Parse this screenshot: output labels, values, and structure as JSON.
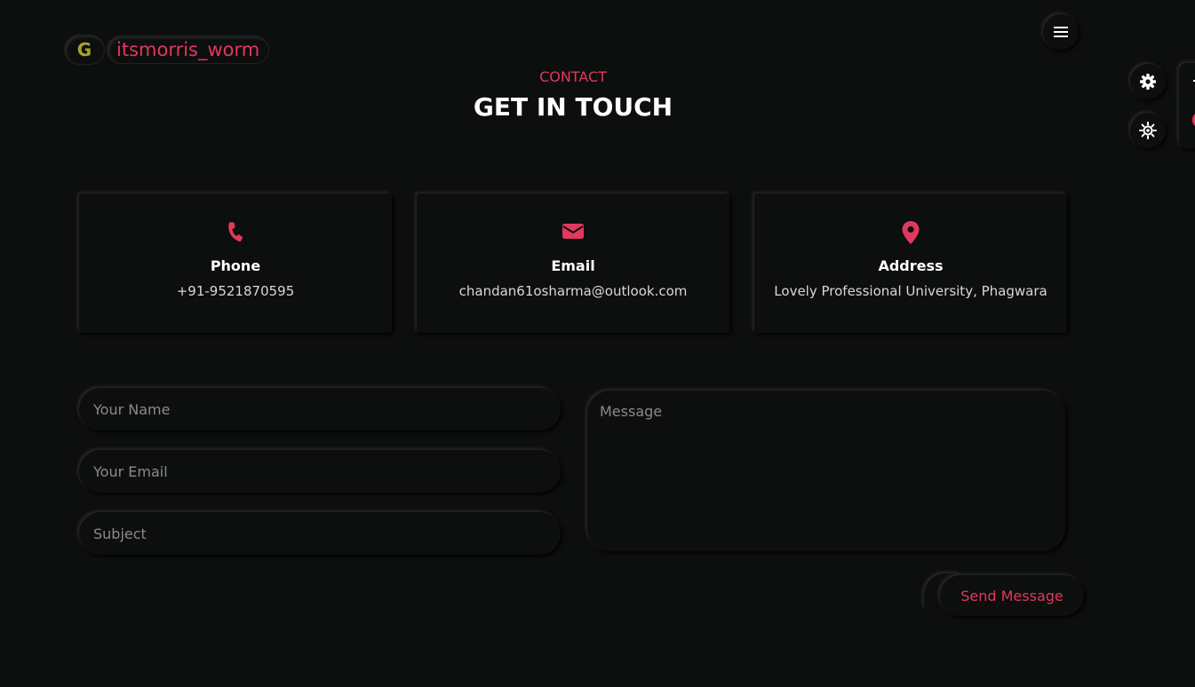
{
  "header": {
    "logo_letter": "G",
    "logo_name": "itsmorris_worm",
    "menu_icon": "hamburger-icon"
  },
  "side_controls": {
    "settings_icon": "gear-icon",
    "theme_icon": "sun-icon"
  },
  "section": {
    "subtitle": "CONTACT",
    "title": "GET IN TOUCH"
  },
  "cards": [
    {
      "icon": "phone-icon",
      "label": "Phone",
      "value": "+91-9521870595"
    },
    {
      "icon": "envelope-icon",
      "label": "Email",
      "value": "chandan61osharma@outlook.com"
    },
    {
      "icon": "map-marker-icon",
      "label": "Address",
      "value": "Lovely Professional University, Phagwara"
    }
  ],
  "form": {
    "name_placeholder": "Your Name",
    "email_placeholder": "Your Email",
    "subject_placeholder": "Subject",
    "message_placeholder": "Message",
    "send_label": "Send Message"
  },
  "colors": {
    "background": "#0d0e0e",
    "accent": "#e0385e",
    "logo_letter": "#a8a32a"
  }
}
